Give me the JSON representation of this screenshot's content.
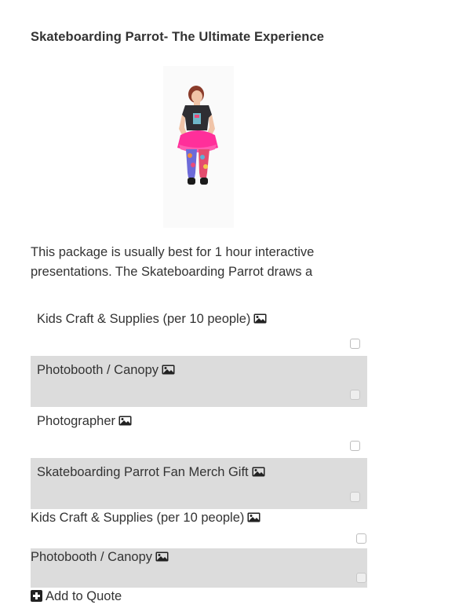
{
  "product": {
    "title": "Skateboarding Parrot- The Ultimate Experience",
    "description": "This package is usually best for 1 hour interactive presentations. The Skateboarding Parrot draws a"
  },
  "addons": [
    {
      "label": "Kids Craft & Supplies (per 10 people)",
      "icon": "image-icon",
      "checked": false
    },
    {
      "label": "Photobooth / Canopy",
      "icon": "image-icon",
      "checked": false
    },
    {
      "label": "Photographer",
      "icon": "image-icon",
      "checked": false
    },
    {
      "label": "Skateboarding Parrot Fan Merch Gift",
      "icon": "image-icon",
      "checked": false
    }
  ],
  "addons_secondary": [
    {
      "label": "Kids Craft & Supplies (per 10 people)",
      "icon": "image-icon",
      "checked": false
    },
    {
      "label": "Photobooth / Canopy",
      "icon": "image-icon",
      "checked": false
    }
  ],
  "actions": {
    "add_to_quote": "Add to Quote",
    "add_icon": "plus-square-icon"
  },
  "colors": {
    "shaded_row": "#dcdcdc",
    "text": "#333333"
  }
}
